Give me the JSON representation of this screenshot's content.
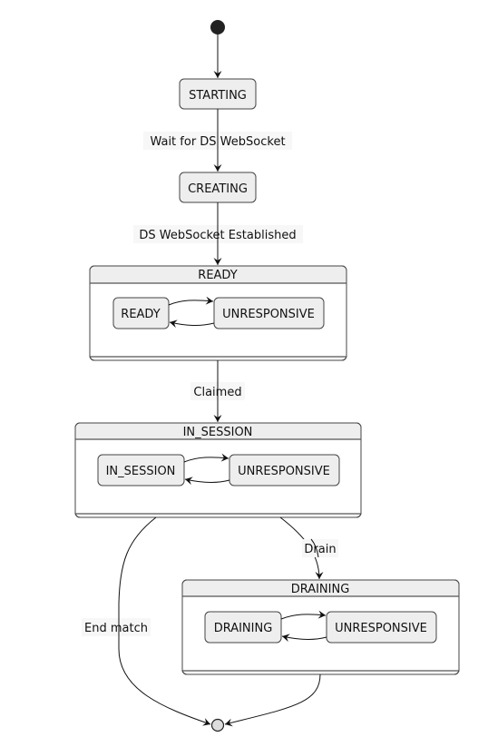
{
  "diagram": {
    "type": "state-machine",
    "initial": "STARTING",
    "states": {
      "starting": "STARTING",
      "creating": "CREATING",
      "ready": {
        "title": "READY",
        "inner_left": "READY",
        "inner_right": "UNRESPONSIVE"
      },
      "in_session": {
        "title": "IN_SESSION",
        "inner_left": "IN_SESSION",
        "inner_right": "UNRESPONSIVE"
      },
      "draining": {
        "title": "DRAINING",
        "inner_left": "DRAINING",
        "inner_right": "UNRESPONSIVE"
      }
    },
    "transitions": {
      "start_to_starting": "",
      "starting_to_creating": "Wait for DS WebSocket",
      "creating_to_ready": "DS WebSocket Established",
      "ready_to_in_session": "Claimed",
      "in_session_to_draining": "Drain",
      "in_session_to_end": "End match",
      "draining_to_end": ""
    },
    "colors": {
      "state_fill": "#eeeeee",
      "state_border": "#444444",
      "edge": "#111111",
      "initial_node": "#222222",
      "final_node": "#dddddd"
    }
  }
}
